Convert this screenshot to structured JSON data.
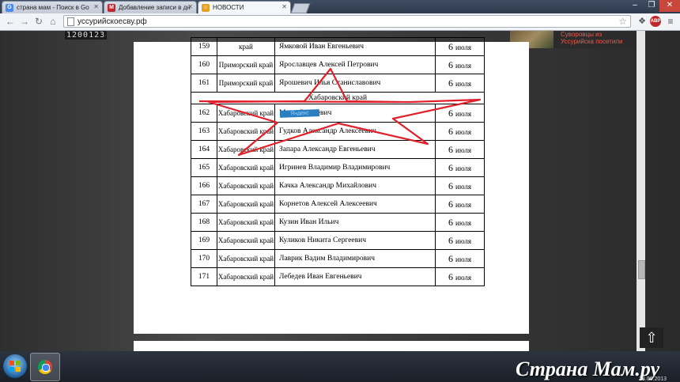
{
  "browser": {
    "tabs": [
      {
        "label": "страна мам - Поиск в Go",
        "favicon": "G",
        "favicon_color": "#4a8af4"
      },
      {
        "label": "Добавление записи в дн",
        "favicon": "M",
        "favicon_color": "#c0272d"
      },
      {
        "label": "НОВОСТИ",
        "favicon": "☺",
        "favicon_color": "#e8a020"
      }
    ],
    "url": "уссурийскоесву.рф",
    "abp_label": "ABP"
  },
  "page": {
    "counter": "1200123",
    "news_text": "Суворовцы из Уссурийска посетили",
    "section_label": "Хабаровский край",
    "stamp_text": "Яндекс",
    "rows": [
      {
        "num": "159",
        "region": "край",
        "name": "Ямковой Иван Евгеньевич",
        "day": "6",
        "month": "июля"
      },
      {
        "num": "160",
        "region": "Приморский край",
        "name": "Ярославцев Алексей Петрович",
        "day": "6",
        "month": "июля"
      },
      {
        "num": "161",
        "region": "Приморский край",
        "name": "Ярошевич Илья Станиславович",
        "day": "6",
        "month": "июля"
      },
      {
        "num": "162",
        "region": "Хабаровский край",
        "name": "Марк Сергеевич",
        "day": "6",
        "month": "июля"
      },
      {
        "num": "163",
        "region": "Хабаровский край",
        "name": "Гудков Александр Алексеевич",
        "day": "6",
        "month": "июля"
      },
      {
        "num": "164",
        "region": "Хабаровский край",
        "name": "Запара Александр Евгеньевич",
        "day": "6",
        "month": "июля"
      },
      {
        "num": "165",
        "region": "Хабаровский край",
        "name": "Игринев Владимир Владимирович",
        "day": "6",
        "month": "июля"
      },
      {
        "num": "166",
        "region": "Хабаровский край",
        "name": "Качка Александр Михайлович",
        "day": "6",
        "month": "июля"
      },
      {
        "num": "167",
        "region": "Хабаровский край",
        "name": "Корнетов Алексей Алексеевич",
        "day": "6",
        "month": "июля"
      },
      {
        "num": "168",
        "region": "Хабаровский край",
        "name": "Кузин Иван Ильич",
        "day": "6",
        "month": "июля"
      },
      {
        "num": "169",
        "region": "Хабаровский край",
        "name": "Куликов Никита Сергеевич",
        "day": "6",
        "month": "июля"
      },
      {
        "num": "170",
        "region": "Хабаровский край",
        "name": "Лаврик Вадим Владимирович",
        "day": "6",
        "month": "июля"
      },
      {
        "num": "171",
        "region": "Хабаровский край",
        "name": "Лебедев Иван Евгеньевич",
        "day": "6",
        "month": "июля"
      }
    ]
  },
  "taskbar": {
    "brand": "Страна Мам.ру",
    "clock": "28.06.2013"
  },
  "colors": {
    "annotation_star": "#e0202a"
  }
}
